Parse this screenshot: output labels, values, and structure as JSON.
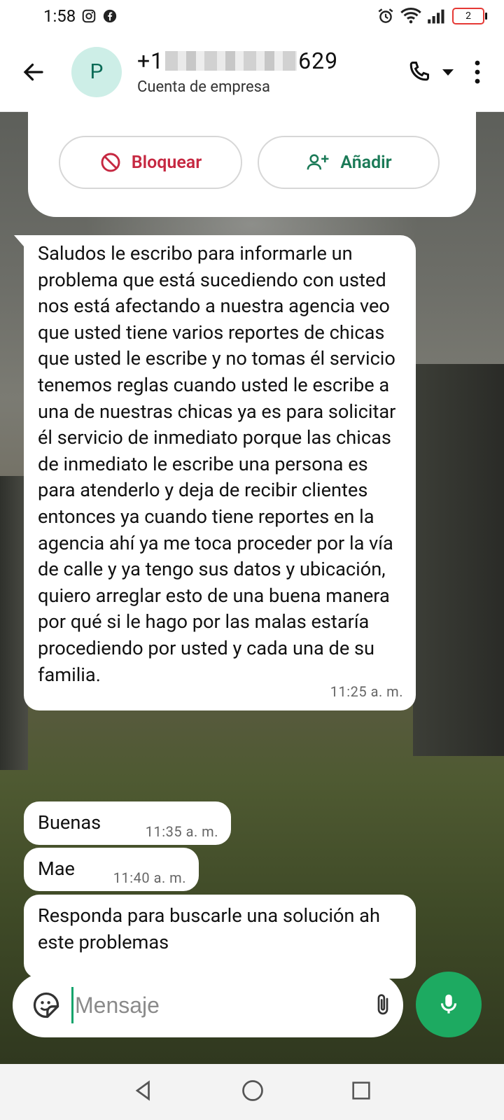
{
  "status_bar": {
    "time": "1:58",
    "left_icons": [
      "instagram-icon",
      "facebook-icon"
    ],
    "right_icons": [
      "alarm-icon",
      "wifi-icon",
      "signal-icon",
      "battery-icon"
    ],
    "battery_level": "2",
    "battery_color": "#e53935"
  },
  "header": {
    "back_icon": "arrow-left-icon",
    "avatar_letter": "P",
    "avatar_bg": "#cdeee7",
    "phone_prefix": "+1",
    "phone_suffix": "629",
    "subtitle": "Cuenta de empresa",
    "call_icon": "phone-icon",
    "dropdown_icon": "caret-down-icon",
    "menu_icon": "more-vertical-icon"
  },
  "contact_card": {
    "block_label": "Bloquear",
    "block_color": "#c62841",
    "add_label": "Añadir",
    "add_color": "#1b7a57"
  },
  "messages": [
    {
      "text": "Saludos le escribo para informarle un problema que está sucediendo con usted nos está afectando a nuestra agencia veo que usted tiene varios reportes de chicas que usted le escribe y no tomas él servicio tenemos reglas cuando usted le escribe a una de nuestras chicas ya es para solicitar él servicio de inmediato porque las chicas de inmediato le escribe una persona es para atenderlo y deja de recibir clientes entonces ya cuando tiene reportes en la agencia ahí ya me toca proceder por la vía de calle y ya tengo  sus datos y ubicación, quiero arreglar esto de una buena manera por qué si le hago por las malas estaría procediendo por usted y cada una de su familia.",
      "time": "11:25 a. m."
    },
    {
      "text": "Buenas",
      "time": "11:35 a. m."
    },
    {
      "text": "Mae",
      "time": "11:40 a. m."
    },
    {
      "text": "Responda para buscarle una solución ah este problemas",
      "time": ""
    }
  ],
  "composer": {
    "placeholder": "Mensaje",
    "emoji_icon": "sticker-icon",
    "attach_icon": "paperclip-icon",
    "camera_icon": "camera-icon",
    "mic_icon": "microphone-icon",
    "mic_color": "#1daa61"
  },
  "nav_bar": {
    "back": "triangle-back-icon",
    "home": "circle-home-icon",
    "recents": "square-recents-icon"
  }
}
